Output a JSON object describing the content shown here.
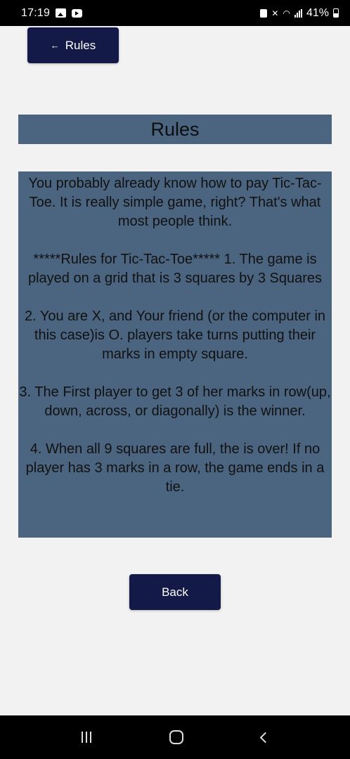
{
  "status_bar": {
    "time": "17:19",
    "battery": "41%",
    "icons": [
      "gallery-icon",
      "youtube-icon",
      "lock-icon",
      "mute-icon",
      "wifi-icon",
      "signal-icon",
      "battery-icon"
    ]
  },
  "top_button": {
    "arrow": "←",
    "label": "Rules"
  },
  "title": "Rules",
  "rules": {
    "paragraphs": [
      "You probably already know how to pay Tic-Tac-Toe. It is really simple game, right? That's what most people think.",
      "*****Rules for Tic-Tac-Toe***** 1. The game is played on a grid that is 3 squares by 3 Squares",
      "2. You are X, and Your friend (or the computer in this case)is O. players take turns putting their marks in empty square.",
      "3. The First player to get 3 of her marks in row(up, down, across, or diagonally) is the winner.",
      "4. When all 9 squares are full, the is over! If no player has 3 marks in a row, the game ends in a tie."
    ]
  },
  "back_button": {
    "label": "Back"
  },
  "nav_bar": {
    "icons": [
      "recents-icon",
      "home-icon",
      "back-icon"
    ]
  },
  "colors": {
    "button_bg": "#141a48",
    "panel_bg": "#4b6580",
    "page_bg": "#f2f2f3"
  }
}
